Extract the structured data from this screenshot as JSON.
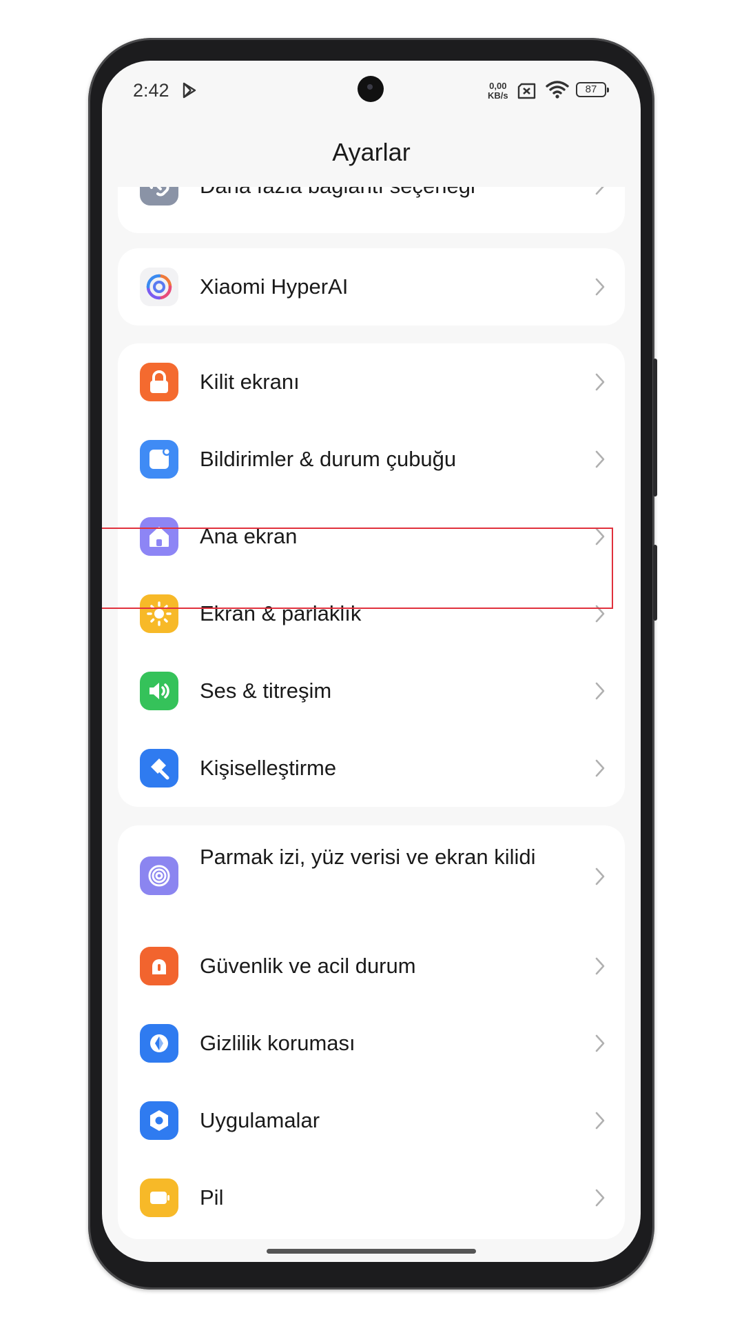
{
  "status_bar": {
    "time": "2:42",
    "net_speed_value": "0,00",
    "net_speed_unit": "KB/s",
    "battery": "87"
  },
  "header": {
    "title": "Ayarlar"
  },
  "sections": [
    {
      "items": [
        {
          "label": "Daha fazla bağlantı seçeneği",
          "icon": "link-icon",
          "color": "#8a93a6"
        }
      ]
    },
    {
      "items": [
        {
          "label": "Xiaomi HyperAI",
          "icon": "hyperai-icon",
          "color": "#f2f2f4"
        }
      ]
    },
    {
      "items": [
        {
          "label": "Kilit ekranı",
          "icon": "lock-icon",
          "color": "#f46a2f"
        },
        {
          "label": "Bildirimler & durum çubuğu",
          "icon": "notification-icon",
          "color": "#3f8bf5"
        },
        {
          "label": "Ana ekran",
          "icon": "home-icon",
          "color": "#8d85f5",
          "highlighted": true
        },
        {
          "label": "Ekran & parlaklık",
          "icon": "sun-icon",
          "color": "#f7b928"
        },
        {
          "label": "Ses & titreşim",
          "icon": "speaker-icon",
          "color": "#35c25a"
        },
        {
          "label": "Kişiselleştirme",
          "icon": "brush-icon",
          "color": "#2f7bf0"
        }
      ]
    },
    {
      "items": [
        {
          "label": "Parmak izi, yüz verisi ve ekran kilidi",
          "icon": "fingerprint-icon",
          "color": "#8b85f0"
        },
        {
          "label": "Güvenlik ve acil durum",
          "icon": "alarm-icon",
          "color": "#f2642e"
        },
        {
          "label": "Gizlilik koruması",
          "icon": "privacy-icon",
          "color": "#2f7bf0"
        },
        {
          "label": "Uygulamalar",
          "icon": "apps-icon",
          "color": "#2f7bf0"
        },
        {
          "label": "Pil",
          "icon": "battery-icon",
          "color": "#f7b928"
        }
      ]
    }
  ]
}
